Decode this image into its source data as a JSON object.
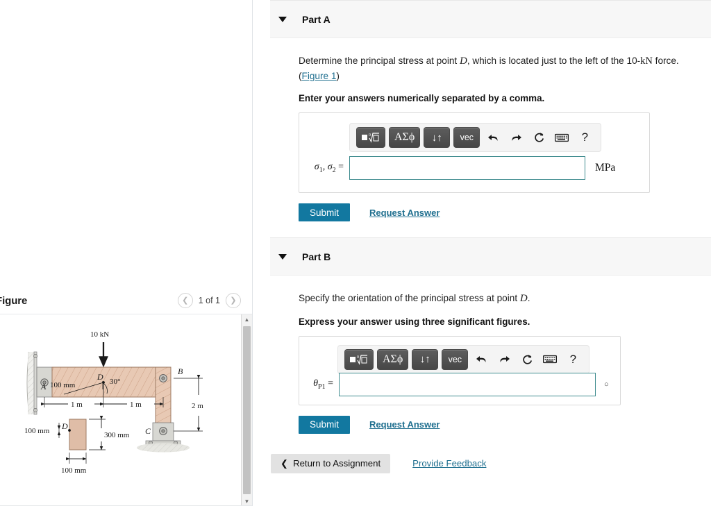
{
  "figure_panel": {
    "title": "Figure",
    "pager": {
      "count_label": "1 of 1",
      "prev_icon": "chevron-left-icon",
      "next_icon": "chevron-right-icon"
    },
    "diagram": {
      "load_label": "10 kN",
      "point_a": "A",
      "point_b": "B",
      "point_c": "C",
      "point_d": "D",
      "point_d_section": "D",
      "offset_label": "100 mm",
      "angle_label": "30°",
      "span_left": "1 m",
      "span_right": "1 m",
      "height_label": "2 m",
      "section_height": "300 mm",
      "section_width": "100 mm",
      "section_offset": "100 mm"
    }
  },
  "parts": [
    {
      "id": "part-a",
      "title": "Part A",
      "caret_icon": "caret-down-icon",
      "question_pre": "Determine the principal stress at point ",
      "question_var": "D",
      "question_post": ", which is located just to the left of the 10-",
      "question_unit": "kN",
      "question_tail": " force.",
      "figure_link": "Figure 1",
      "instruction": "Enter your answers numerically separated by a comma.",
      "math_toolbar": [
        {
          "name": "template-sqrt-button",
          "label": "■√□",
          "kind": "template"
        },
        {
          "name": "greek-symbols-button",
          "label": "ΑΣϕ",
          "kind": "greek"
        },
        {
          "name": "sup-sub-button",
          "label": "↓↑",
          "kind": "plain"
        },
        {
          "name": "vector-button",
          "label": "vec",
          "kind": "vec"
        },
        {
          "name": "undo-button",
          "label": "↩",
          "kind": "icon"
        },
        {
          "name": "redo-button",
          "label": "↪",
          "kind": "icon"
        },
        {
          "name": "reset-button",
          "label": "↻",
          "kind": "icon"
        },
        {
          "name": "keyboard-button",
          "label": "⌨",
          "kind": "icon"
        },
        {
          "name": "help-button",
          "label": "?",
          "kind": "icon"
        }
      ],
      "answer_label_main": "σ",
      "answer_label_sub1": "1",
      "answer_label_mid": ", σ",
      "answer_label_sub2": "2",
      "answer_label_eq": " =",
      "answer_value": "",
      "answer_placeholder": "",
      "unit": "MPa",
      "submit_label": "Submit",
      "request_answer_label": "Request Answer"
    },
    {
      "id": "part-b",
      "title": "Part B",
      "caret_icon": "caret-down-icon",
      "question_pre": "Specify the orientation of the principal stress at point ",
      "question_var": "D",
      "question_post": ".",
      "instruction": "Express your answer using three significant figures.",
      "math_toolbar": [
        {
          "name": "template-sqrt-button",
          "label": "■√□",
          "kind": "template"
        },
        {
          "name": "greek-symbols-button",
          "label": "ΑΣϕ",
          "kind": "greek"
        },
        {
          "name": "sup-sub-button",
          "label": "↓↑",
          "kind": "plain"
        },
        {
          "name": "vector-button",
          "label": "vec",
          "kind": "vec"
        },
        {
          "name": "undo-button",
          "label": "↩",
          "kind": "icon"
        },
        {
          "name": "redo-button",
          "label": "↪",
          "kind": "icon"
        },
        {
          "name": "reset-button",
          "label": "↻",
          "kind": "icon"
        },
        {
          "name": "keyboard-button",
          "label": "⌨",
          "kind": "icon"
        },
        {
          "name": "help-button",
          "label": "?",
          "kind": "icon"
        }
      ],
      "answer_label_main": "θ",
      "answer_label_sub1": "P1",
      "answer_label_eq": " =",
      "answer_value": "",
      "answer_placeholder": "",
      "unit": "○",
      "submit_label": "Submit",
      "request_answer_label": "Request Answer"
    }
  ],
  "footer": {
    "return_label": "Return to Assignment",
    "return_icon": "chevron-left-icon",
    "feedback_label": "Provide Feedback"
  },
  "colors": {
    "accent_teal": "#1278a0",
    "link": "#1f6f8f",
    "input_border": "#3f8c8f",
    "header_bg": "#f7f7f7",
    "wood": "#e3c4ad"
  }
}
